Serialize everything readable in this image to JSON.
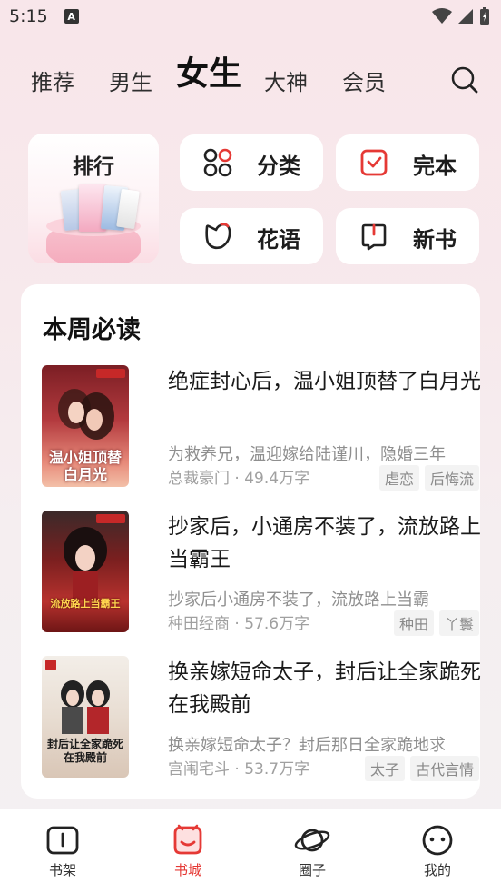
{
  "status_bar": {
    "time": "5:15",
    "notif_icon": "A"
  },
  "tabs": [
    {
      "label": "推荐",
      "active": false
    },
    {
      "label": "男生",
      "active": false
    },
    {
      "label": "女生",
      "active": true
    },
    {
      "label": "大神",
      "active": false
    },
    {
      "label": "会员",
      "active": false
    }
  ],
  "rank": {
    "title": "排行"
  },
  "quick": {
    "category": "分类",
    "complete": "完本",
    "huayu": "花语",
    "newbook": "新书"
  },
  "weekly": {
    "title": "本周必读",
    "books": [
      {
        "title": "绝症封心后，温小姐顶替了白月光",
        "desc": "为救养兄，温迎嫁给陆谨川，隐婚三年",
        "meta": "总裁豪门 · 49.4万字",
        "tags": [
          "虐恋",
          "后悔流"
        ],
        "cover_text": "温小姐顶替白月光"
      },
      {
        "title": "抄家后，小通房不装了，流放路上当霸王",
        "desc": "抄家后小通房不装了，流放路上当霸",
        "meta": "种田经商 · 57.6万字",
        "tags": [
          "种田",
          "丫鬟"
        ],
        "cover_text": "流放路上当霸王"
      },
      {
        "title": "换亲嫁短命太子，封后让全家跪死在我殿前",
        "desc": "换亲嫁短命太子？封后那日全家跪地求",
        "meta": "宫闱宅斗 · 53.7万字",
        "tags": [
          "太子",
          "古代言情"
        ],
        "cover_text": "封后让全家跪死在我殿前"
      }
    ]
  },
  "nav": [
    {
      "label": "书架",
      "active": false
    },
    {
      "label": "书城",
      "active": true
    },
    {
      "label": "圈子",
      "active": false
    },
    {
      "label": "我的",
      "active": false
    }
  ],
  "colors": {
    "accent": "#e53935",
    "background": "#f8e6ea"
  }
}
